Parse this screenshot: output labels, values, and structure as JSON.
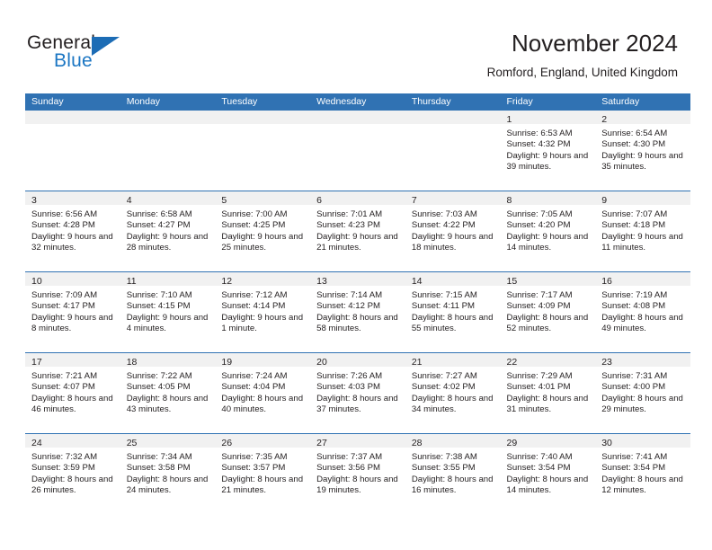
{
  "brand": {
    "word_one": "General",
    "word_two": "Blue",
    "triangle_color": "#1c6cb5",
    "blue_text_color": "#1b76c3"
  },
  "header": {
    "title": "November 2024",
    "location": "Romford, England, United Kingdom"
  },
  "theme": {
    "header_blue": "#3072b3",
    "daynum_strip": "#f1f1f1",
    "text": "#231f20"
  },
  "calendar": {
    "weekday_headers": [
      "Sunday",
      "Monday",
      "Tuesday",
      "Wednesday",
      "Thursday",
      "Friday",
      "Saturday"
    ],
    "weeks": [
      [
        {
          "empty": true
        },
        {
          "empty": true
        },
        {
          "empty": true
        },
        {
          "empty": true
        },
        {
          "empty": true
        },
        {
          "day": "1",
          "sunrise": "Sunrise: 6:53 AM",
          "sunset": "Sunset: 4:32 PM",
          "daylight": "Daylight: 9 hours and 39 minutes."
        },
        {
          "day": "2",
          "sunrise": "Sunrise: 6:54 AM",
          "sunset": "Sunset: 4:30 PM",
          "daylight": "Daylight: 9 hours and 35 minutes."
        }
      ],
      [
        {
          "day": "3",
          "sunrise": "Sunrise: 6:56 AM",
          "sunset": "Sunset: 4:28 PM",
          "daylight": "Daylight: 9 hours and 32 minutes."
        },
        {
          "day": "4",
          "sunrise": "Sunrise: 6:58 AM",
          "sunset": "Sunset: 4:27 PM",
          "daylight": "Daylight: 9 hours and 28 minutes."
        },
        {
          "day": "5",
          "sunrise": "Sunrise: 7:00 AM",
          "sunset": "Sunset: 4:25 PM",
          "daylight": "Daylight: 9 hours and 25 minutes."
        },
        {
          "day": "6",
          "sunrise": "Sunrise: 7:01 AM",
          "sunset": "Sunset: 4:23 PM",
          "daylight": "Daylight: 9 hours and 21 minutes."
        },
        {
          "day": "7",
          "sunrise": "Sunrise: 7:03 AM",
          "sunset": "Sunset: 4:22 PM",
          "daylight": "Daylight: 9 hours and 18 minutes."
        },
        {
          "day": "8",
          "sunrise": "Sunrise: 7:05 AM",
          "sunset": "Sunset: 4:20 PM",
          "daylight": "Daylight: 9 hours and 14 minutes."
        },
        {
          "day": "9",
          "sunrise": "Sunrise: 7:07 AM",
          "sunset": "Sunset: 4:18 PM",
          "daylight": "Daylight: 9 hours and 11 minutes."
        }
      ],
      [
        {
          "day": "10",
          "sunrise": "Sunrise: 7:09 AM",
          "sunset": "Sunset: 4:17 PM",
          "daylight": "Daylight: 9 hours and 8 minutes."
        },
        {
          "day": "11",
          "sunrise": "Sunrise: 7:10 AM",
          "sunset": "Sunset: 4:15 PM",
          "daylight": "Daylight: 9 hours and 4 minutes."
        },
        {
          "day": "12",
          "sunrise": "Sunrise: 7:12 AM",
          "sunset": "Sunset: 4:14 PM",
          "daylight": "Daylight: 9 hours and 1 minute."
        },
        {
          "day": "13",
          "sunrise": "Sunrise: 7:14 AM",
          "sunset": "Sunset: 4:12 PM",
          "daylight": "Daylight: 8 hours and 58 minutes."
        },
        {
          "day": "14",
          "sunrise": "Sunrise: 7:15 AM",
          "sunset": "Sunset: 4:11 PM",
          "daylight": "Daylight: 8 hours and 55 minutes."
        },
        {
          "day": "15",
          "sunrise": "Sunrise: 7:17 AM",
          "sunset": "Sunset: 4:09 PM",
          "daylight": "Daylight: 8 hours and 52 minutes."
        },
        {
          "day": "16",
          "sunrise": "Sunrise: 7:19 AM",
          "sunset": "Sunset: 4:08 PM",
          "daylight": "Daylight: 8 hours and 49 minutes."
        }
      ],
      [
        {
          "day": "17",
          "sunrise": "Sunrise: 7:21 AM",
          "sunset": "Sunset: 4:07 PM",
          "daylight": "Daylight: 8 hours and 46 minutes."
        },
        {
          "day": "18",
          "sunrise": "Sunrise: 7:22 AM",
          "sunset": "Sunset: 4:05 PM",
          "daylight": "Daylight: 8 hours and 43 minutes."
        },
        {
          "day": "19",
          "sunrise": "Sunrise: 7:24 AM",
          "sunset": "Sunset: 4:04 PM",
          "daylight": "Daylight: 8 hours and 40 minutes."
        },
        {
          "day": "20",
          "sunrise": "Sunrise: 7:26 AM",
          "sunset": "Sunset: 4:03 PM",
          "daylight": "Daylight: 8 hours and 37 minutes."
        },
        {
          "day": "21",
          "sunrise": "Sunrise: 7:27 AM",
          "sunset": "Sunset: 4:02 PM",
          "daylight": "Daylight: 8 hours and 34 minutes."
        },
        {
          "day": "22",
          "sunrise": "Sunrise: 7:29 AM",
          "sunset": "Sunset: 4:01 PM",
          "daylight": "Daylight: 8 hours and 31 minutes."
        },
        {
          "day": "23",
          "sunrise": "Sunrise: 7:31 AM",
          "sunset": "Sunset: 4:00 PM",
          "daylight": "Daylight: 8 hours and 29 minutes."
        }
      ],
      [
        {
          "day": "24",
          "sunrise": "Sunrise: 7:32 AM",
          "sunset": "Sunset: 3:59 PM",
          "daylight": "Daylight: 8 hours and 26 minutes."
        },
        {
          "day": "25",
          "sunrise": "Sunrise: 7:34 AM",
          "sunset": "Sunset: 3:58 PM",
          "daylight": "Daylight: 8 hours and 24 minutes."
        },
        {
          "day": "26",
          "sunrise": "Sunrise: 7:35 AM",
          "sunset": "Sunset: 3:57 PM",
          "daylight": "Daylight: 8 hours and 21 minutes."
        },
        {
          "day": "27",
          "sunrise": "Sunrise: 7:37 AM",
          "sunset": "Sunset: 3:56 PM",
          "daylight": "Daylight: 8 hours and 19 minutes."
        },
        {
          "day": "28",
          "sunrise": "Sunrise: 7:38 AM",
          "sunset": "Sunset: 3:55 PM",
          "daylight": "Daylight: 8 hours and 16 minutes."
        },
        {
          "day": "29",
          "sunrise": "Sunrise: 7:40 AM",
          "sunset": "Sunset: 3:54 PM",
          "daylight": "Daylight: 8 hours and 14 minutes."
        },
        {
          "day": "30",
          "sunrise": "Sunrise: 7:41 AM",
          "sunset": "Sunset: 3:54 PM",
          "daylight": "Daylight: 8 hours and 12 minutes."
        }
      ]
    ]
  }
}
